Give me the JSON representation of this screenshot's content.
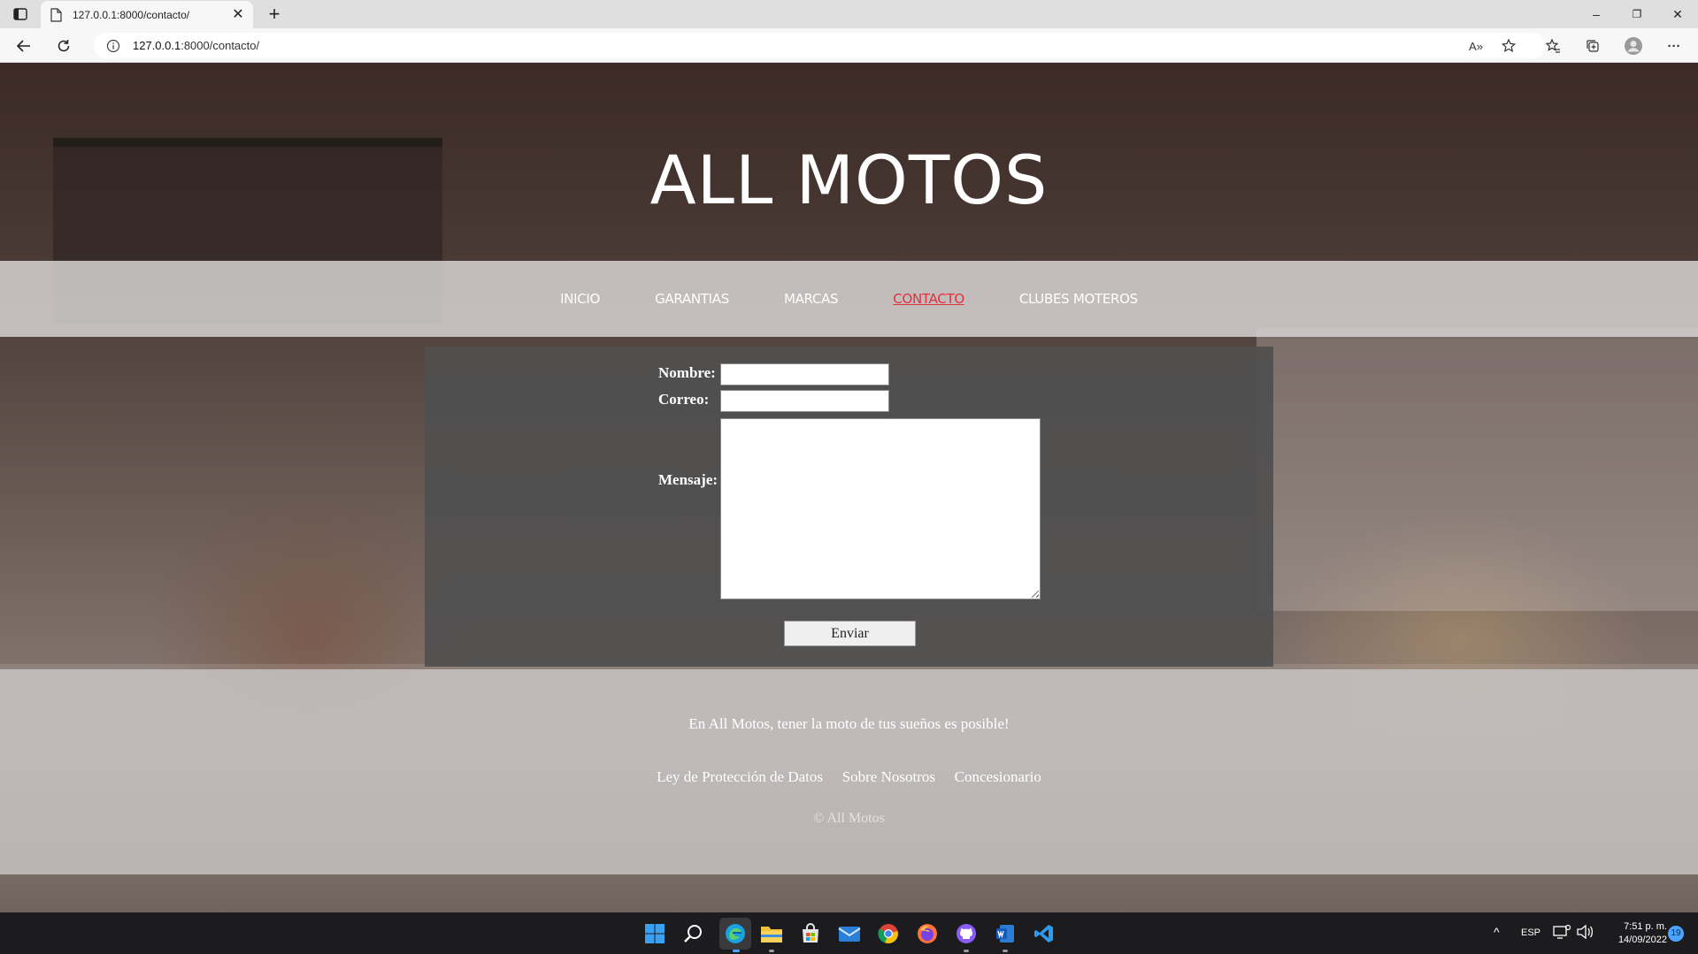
{
  "browser": {
    "tab_title": "127.0.0.1:8000/contacto/",
    "tab_close": "✕",
    "new_tab": "+",
    "url_host": "127.0.0.1",
    "url_rest": ":8000/contacto/",
    "window_controls": [
      "–",
      "❐",
      "✕"
    ],
    "icons": [
      "sidebar-icon",
      "page-icon",
      "back-icon",
      "refresh-icon",
      "info-icon",
      "read-aloud-icon",
      "add-favorite-icon",
      "favorites-icon",
      "collections-icon",
      "profile-icon",
      "more-icon"
    ],
    "read_aloud": "A»",
    "more": "···"
  },
  "site": {
    "title": "ALL MOTOS",
    "nav": [
      {
        "label": "INICIO",
        "active": false
      },
      {
        "label": "GARANTIAS",
        "active": false
      },
      {
        "label": "MARCAS",
        "active": false
      },
      {
        "label": "CONTACTO",
        "active": true
      },
      {
        "label": "CLUBES MOTEROS",
        "active": false
      }
    ],
    "form": {
      "name_label": "Nombre:",
      "name_value": "",
      "email_label": "Correo:",
      "email_value": "",
      "message_label": "Mensaje:",
      "message_value": "",
      "submit_label": "Enviar"
    },
    "footer": {
      "slogan": "En All Motos, tener la moto de tus sueños es posible!",
      "links": [
        "Ley de Protección de Datos",
        "Sobre Nosotros",
        "Concesionario"
      ],
      "separator": "·",
      "copyright": "© All Motos"
    }
  },
  "taskbar": {
    "apps": [
      "start-icon",
      "search-icon",
      "edge-icon",
      "file-explorer-icon",
      "store-icon",
      "mail-icon",
      "chrome-icon",
      "firefox-icon",
      "github-desktop-icon",
      "word-icon",
      "vscode-icon"
    ],
    "tray_chevron": "^",
    "language": "ESP",
    "time": "7:51 p. m.",
    "date": "14/09/2022",
    "notification_count": "19"
  },
  "colors": {
    "accent_active_nav": "#e2303d",
    "form_panel": "#505050",
    "taskbar": "#1c1c1f"
  }
}
